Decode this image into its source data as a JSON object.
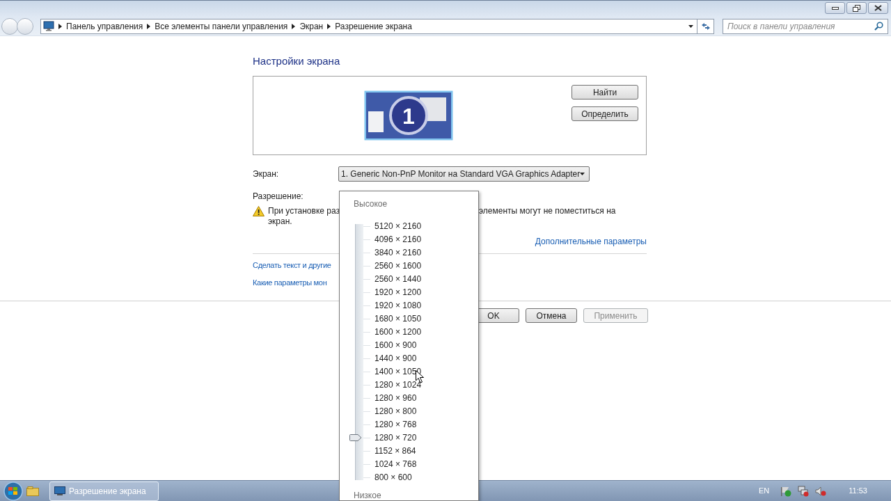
{
  "address_bar": {
    "path": [
      "Панель управления",
      "Все элементы панели управления",
      "Экран",
      "Разрешение экрана"
    ]
  },
  "search": {
    "placeholder": "Поиск в панели управления"
  },
  "heading": "Настройки экрана",
  "monitor_preview": {
    "number": "1"
  },
  "preview_buttons": [
    "Найти",
    "Определить"
  ],
  "display_field": {
    "label": "Экран:",
    "value": "1. Generic Non-PnP Monitor на Standard VGA Graphics Adapter"
  },
  "resolution_field": {
    "label": "Разрешение:"
  },
  "warning": {
    "parts": [
      "При установке раз",
      "элементы могут не поместиться на",
      "экран."
    ]
  },
  "advanced_link": "Дополнительные параметры",
  "links": [
    "Сделать текст и другие",
    "Какие параметры мон"
  ],
  "dialog_buttons": [
    {
      "label": "OK",
      "disabled": false
    },
    {
      "label": "Отмена",
      "disabled": false
    },
    {
      "label": "Применить",
      "disabled": true
    }
  ],
  "resolution_popup": {
    "high_label": "Высокое",
    "low_label": "Низкое",
    "options": [
      {
        "label": "5120 × 2160",
        "selected": false
      },
      {
        "label": "4096 × 2160",
        "selected": false
      },
      {
        "label": "3840 × 2160",
        "selected": false
      },
      {
        "label": "2560 × 1600",
        "selected": false
      },
      {
        "label": "2560 × 1440",
        "selected": false
      },
      {
        "label": "1920 × 1200",
        "selected": false
      },
      {
        "label": "1920 × 1080",
        "selected": false
      },
      {
        "label": "1680 × 1050",
        "selected": false
      },
      {
        "label": "1600 × 1200",
        "selected": false
      },
      {
        "label": "1600 × 900",
        "selected": false
      },
      {
        "label": "1440 × 900",
        "selected": false
      },
      {
        "label": "1400 × 1050",
        "selected": false
      },
      {
        "label": "1280 × 1024",
        "selected": false
      },
      {
        "label": "1280 × 960",
        "selected": false
      },
      {
        "label": "1280 × 800",
        "selected": false
      },
      {
        "label": "1280 × 768",
        "selected": false
      },
      {
        "label": "1280 × 720",
        "selected": true
      },
      {
        "label": "1152 × 864",
        "selected": false
      },
      {
        "label": "1024 × 768",
        "selected": false
      },
      {
        "label": "800 × 600",
        "selected": false
      }
    ]
  },
  "taskbar": {
    "task": {
      "label": "Разрешение экрана",
      "selected": true
    },
    "language": "EN",
    "clock": "11:53"
  }
}
